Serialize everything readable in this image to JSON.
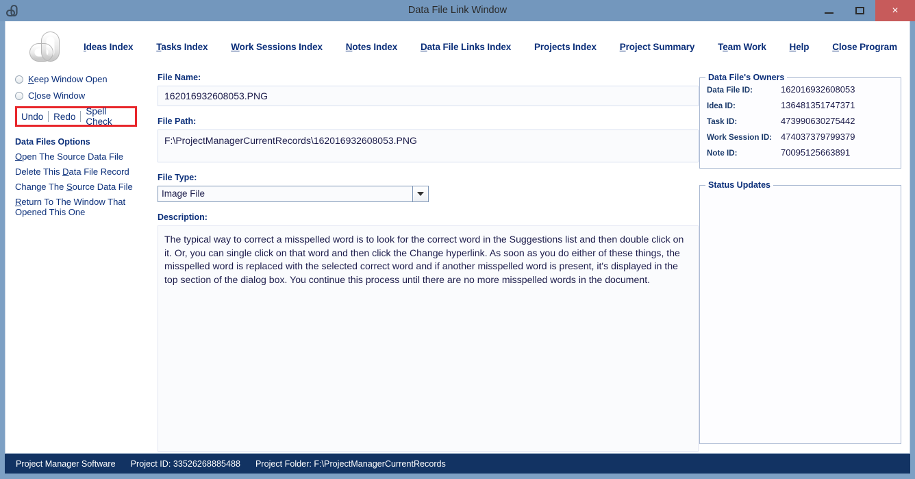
{
  "window": {
    "title": "Data File Link Window",
    "icon": "app-logo-icon",
    "minimize_label": "–",
    "maximize_label": "□",
    "close_label": "×"
  },
  "nav": {
    "items": [
      {
        "label": "Ideas Index",
        "accel": "I"
      },
      {
        "label": "Tasks Index",
        "accel": "T"
      },
      {
        "label": "Work Sessions Index",
        "accel": "W"
      },
      {
        "label": "Notes Index",
        "accel": "N"
      },
      {
        "label": "Data File Links Index",
        "accel": "D"
      },
      {
        "label": "Projects Index",
        "accel": ""
      },
      {
        "label": "Project Summary",
        "accel": "P"
      },
      {
        "label": "Team Work",
        "accel": "e"
      },
      {
        "label": "Help",
        "accel": "H"
      },
      {
        "label": "Close Program",
        "accel": "C"
      }
    ]
  },
  "sidebar": {
    "radios": [
      {
        "label": "Keep Window Open",
        "accel": "K",
        "selected": false
      },
      {
        "label": "Close Window",
        "accel": "l",
        "selected": false
      }
    ],
    "edit_links": [
      "Undo",
      "Redo",
      "Spell Check"
    ],
    "options_heading": "Data Files Options",
    "options": [
      {
        "label": "Open The Source Data File",
        "accel": "O"
      },
      {
        "label": "Delete This Data File Record",
        "accel": "D"
      },
      {
        "label": "Change The Source Data File",
        "accel": "S"
      },
      {
        "label": "Return To The Window That Opened This One",
        "accel": "R"
      }
    ]
  },
  "form": {
    "file_name_label": "File Name:",
    "file_name_value": "162016932608053.PNG",
    "file_path_label": "File Path:",
    "file_path_value": "F:\\ProjectManagerCurrentRecords\\162016932608053.PNG",
    "file_type_label": "File Type:",
    "file_type_value": "Image File",
    "description_label": "Description:",
    "description_value": "The typical way to correct a misspelled word is to look for the correct word in the Suggestions list and then double click on it. Or, you can single click on that word and then click the Change hyperlink. As soon as you do either of these things, the misspelled word is replaced with the selected correct word and if another misspelled word is present, it's displayed in the top section of the dialog box. You continue this process until there are no more misspelled words in the document."
  },
  "owners": {
    "title": "Data File's Owners",
    "rows": [
      {
        "key": "Data File ID:",
        "value": "162016932608053"
      },
      {
        "key": "Idea ID:",
        "value": "136481351747371"
      },
      {
        "key": "Task ID:",
        "value": "473990630275442"
      },
      {
        "key": "Work Session ID:",
        "value": "474037379799379"
      },
      {
        "key": "Note ID:",
        "value": "70095125663891"
      }
    ]
  },
  "status_updates": {
    "title": "Status Updates",
    "content": ""
  },
  "footer": {
    "app_name": "Project Manager Software",
    "project_id_label": "Project ID:",
    "project_id_value": "33526268885488",
    "project_folder_label": "Project Folder:",
    "project_folder_value": "F:\\ProjectManagerCurrentRecords"
  },
  "colors": {
    "titlebar": "#7397bd",
    "close_button": "#c75b5b",
    "link_blue": "#0b2f7a",
    "footer_navy": "#123363",
    "annotation_red": "#e8262b"
  }
}
